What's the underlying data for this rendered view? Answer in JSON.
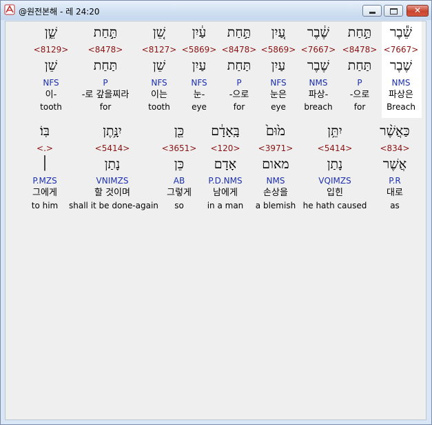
{
  "window": {
    "title": "@원전본해 - 레 24:20"
  },
  "rows": [
    {
      "words": [
        {
          "heb": "שֵׁ֕בֶר",
          "strong": "<7667>",
          "lemma": "שֶׁבֶר",
          "pos": "NMS",
          "ko": "파상은",
          "en": "Breach"
        },
        {
          "heb": "תַּ֣חַת",
          "strong": "<8478>",
          "lemma": "תַּחַת",
          "pos": "P",
          "ko": "-으로",
          "en": "for"
        },
        {
          "heb": "שֶׁ֔בֶר",
          "strong": "<7667>",
          "lemma": "שֶׁבֶר",
          "pos": "NMS",
          "ko": "파상-",
          "en": "breach"
        },
        {
          "heb": "עַ֚יִן",
          "strong": "<5869>",
          "lemma": "עַיִן",
          "pos": "NFS",
          "ko": "눈은",
          "en": "eye"
        },
        {
          "heb": "תַּ֣חַת",
          "strong": "<8478>",
          "lemma": "תַּחַת",
          "pos": "P",
          "ko": "-으로",
          "en": "for"
        },
        {
          "heb": "עַ֔יִן",
          "strong": "<5869>",
          "lemma": "עַיִן",
          "pos": "NFS",
          "ko": "눈-",
          "en": "eye"
        },
        {
          "heb": "שֵׁ֚ן",
          "strong": "<8127>",
          "lemma": "שֵׁן",
          "pos": "NFS",
          "ko": "이는",
          "en": "tooth"
        },
        {
          "heb": "תַּ֣חַת",
          "strong": "<8478>",
          "lemma": "תַּחַת",
          "pos": "P",
          "ko": "-로 갚을찌라",
          "en": "for"
        },
        {
          "heb": "שֵׁ֑ן",
          "strong": "<8129>",
          "lemma": "שֵׁן",
          "pos": "NFS",
          "ko": "이-",
          "en": "tooth"
        }
      ]
    },
    {
      "words": [
        {
          "heb": "כַּאֲשֶׁ֨ר",
          "strong": "<834>",
          "lemma": "אֲשֶׁר",
          "pos": "P.R",
          "ko": "대로",
          "en": "as"
        },
        {
          "heb": "יִתֵּ֥ן",
          "strong": "<5414>",
          "lemma": "נָתַן",
          "pos": "VQIMZS",
          "ko": "입힌",
          "en": "he hath caused"
        },
        {
          "heb": "מ֙וּם֙",
          "strong": "<3971>",
          "lemma": "מאום",
          "pos": "NMS",
          "ko": "손상을",
          "en": "a blemish"
        },
        {
          "heb": "בָּֽאָדָ֔ם",
          "strong": "<120>",
          "lemma": "אָדָם",
          "pos": "P.D.NMS",
          "ko": "남에게",
          "en": "in a man"
        },
        {
          "heb": "כֵּ֖ן",
          "strong": "<3651>",
          "lemma": "כֵּן",
          "pos": "AB",
          "ko": "그렇게",
          "en": "so"
        },
        {
          "heb": "יִנָּ֥תֶן",
          "strong": "<5414>",
          "lemma": "נָתַן",
          "pos": "VNIMZS",
          "ko": "할 것이며",
          "en": "shall it be done-again"
        },
        {
          "heb": "בּֽוֹ׃",
          "strong": "<.>",
          "lemma": "׀",
          "pos": "P.MZS",
          "ko": "그에게",
          "en": "to him"
        }
      ]
    }
  ]
}
